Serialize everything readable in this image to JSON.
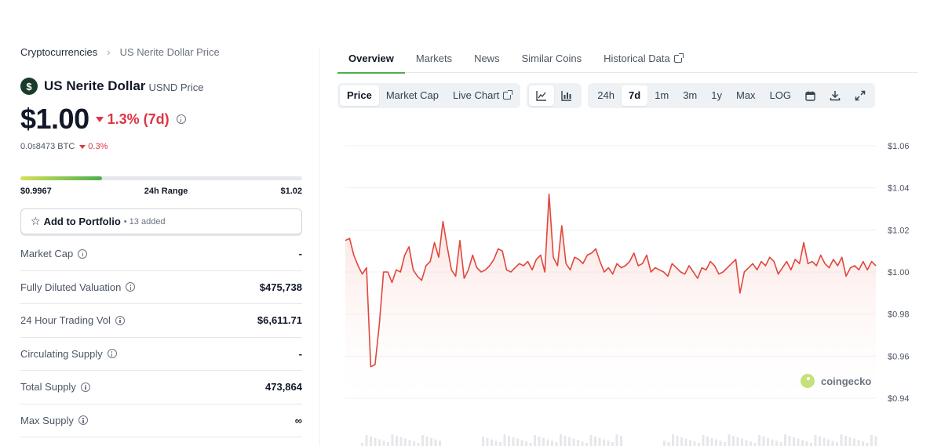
{
  "breadcrumb": {
    "root": "Cryptocurrencies",
    "current": "US Nerite Dollar Price"
  },
  "coin": {
    "logo_letter": "$",
    "name": "US Nerite Dollar",
    "symbol_label": "USND Price",
    "price": "$1.00",
    "change_7d": "1.3% (7d)",
    "btc_price_prefix": "0.0",
    "btc_price_sub": "5",
    "btc_price_suffix": "8473 BTC",
    "btc_change": "0.3%"
  },
  "range": {
    "low": "$0.9967",
    "label": "24h Range",
    "high": "$1.02",
    "fill_fraction": 0.29
  },
  "portfolio": {
    "label": "Add to Portfolio",
    "added": "• 13 added"
  },
  "stats": [
    {
      "label": "Market Cap",
      "value": "-"
    },
    {
      "label": "Fully Diluted Valuation",
      "value": "$475,738"
    },
    {
      "label": "24 Hour Trading Vol",
      "value": "$6,611.71"
    },
    {
      "label": "Circulating Supply",
      "value": "-"
    },
    {
      "label": "Total Supply",
      "value": "473,864"
    },
    {
      "label": "Max Supply",
      "value": "∞"
    }
  ],
  "tabs": [
    "Overview",
    "Markets",
    "News",
    "Similar Coins",
    "Historical Data"
  ],
  "toolbar": {
    "view_tabs": [
      "Price",
      "Market Cap",
      "Live Chart"
    ],
    "ranges": [
      "24h",
      "7d",
      "1m",
      "3m",
      "1y",
      "Max",
      "LOG"
    ]
  },
  "watermark": "coingecko",
  "colors": {
    "line": "#e0473c",
    "area_top": "#f9d2cd",
    "accent_green": "#4caf50",
    "down_red": "#dc3545"
  },
  "chart_data": {
    "type": "area",
    "ylim": [
      0.94,
      1.06
    ],
    "yticks": [
      "$1.06",
      "$1.04",
      "$1.02",
      "$1.00",
      "$0.98",
      "$0.96",
      "$0.94"
    ],
    "ytick_values": [
      1.06,
      1.04,
      1.02,
      1.0,
      0.98,
      0.96,
      0.94
    ],
    "grid": true,
    "series": [
      {
        "values": [
          1.015,
          1.016,
          1.008,
          1.003,
          0.999,
          1.002,
          0.955,
          0.956,
          0.975,
          1.0,
          1.0,
          0.995,
          1.001,
          1.0,
          1.008,
          1.012,
          1.001,
          0.998,
          0.996,
          1.003,
          1.005,
          1.014,
          1.007,
          1.024,
          1.012,
          1.001,
          0.998,
          1.015,
          0.997,
          1.001,
          1.008,
          1.002,
          1.0,
          1.001,
          1.003,
          1.006,
          1.011,
          1.01,
          1.001,
          1.0,
          1.002,
          1.004,
          1.003,
          1.005,
          1.001,
          1.006,
          1.008,
          1.0,
          1.037,
          1.007,
          1.003,
          1.022,
          1.004,
          1.001,
          1.007,
          1.006,
          1.004,
          1.008,
          1.009,
          1.011,
          1.005,
          1.0,
          1.002,
          0.999,
          1.004,
          1.002,
          1.003,
          1.005,
          1.009,
          1.003,
          1.004,
          1.008,
          1.0,
          1.002,
          1.001,
          1.0,
          0.998,
          1.004,
          1.002,
          1.0,
          0.999,
          1.003,
          1.0,
          0.997,
          1.002,
          1.001,
          1.005,
          1.003,
          0.999,
          1.0,
          1.002,
          1.004,
          1.006,
          0.99,
          1.0,
          1.002,
          1.004,
          1.001,
          1.005,
          1.003,
          1.007,
          1.005,
          0.999,
          1.002,
          1.005,
          1.001,
          1.006,
          1.004,
          1.014,
          1.004,
          1.005,
          1.003,
          1.008,
          1.004,
          1.002,
          1.006,
          1.003,
          1.007,
          0.998,
          1.002,
          1.003,
          1.001,
          1.005,
          1.001,
          1.005,
          1.003
        ]
      }
    ]
  }
}
